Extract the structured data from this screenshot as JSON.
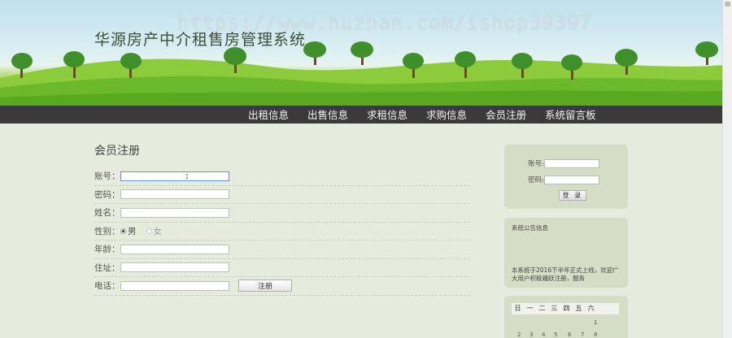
{
  "site": {
    "title": "华源房产中介租售房管理系统",
    "watermark": "https://www.huzhan.com/ishop39397"
  },
  "nav": {
    "items": [
      "出租信息",
      "出售信息",
      "求租信息",
      "求购信息",
      "会员注册",
      "系统留言板"
    ]
  },
  "register": {
    "title": "会员注册",
    "account_label": "账号：",
    "password_label": "密码：",
    "name_label": "姓名：",
    "gender_label": "性别：",
    "gender_male": "男",
    "gender_female": "女",
    "age_label": "年龄：",
    "address_label": "住址：",
    "phone_label": "电话：",
    "submit_label": "注册"
  },
  "login": {
    "account_label": "账号:",
    "password_label": "密码:",
    "button_label": "登 录"
  },
  "notice": {
    "title": "系统公告信息",
    "body": "本系统于2016下半年正式上线，欢迎广大用户积极踊跃注册，服务"
  },
  "calendar": {
    "weekdays": [
      "日",
      "一",
      "二",
      "三",
      "四",
      "五",
      "六"
    ],
    "first_row": [
      "1"
    ],
    "second_row": [
      "2",
      "3",
      "4",
      "5",
      "6",
      "7",
      "8"
    ]
  },
  "colors": {
    "nav_bg": "#3a3a3a",
    "page_bg": "#e6ecdd",
    "card_bg": "#d6ddc6"
  }
}
